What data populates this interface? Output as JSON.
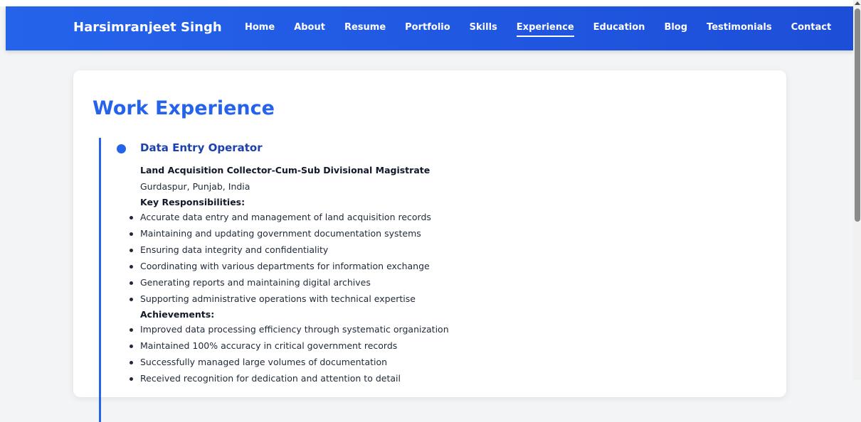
{
  "header": {
    "brand": "Harsimranjeet Singh",
    "nav": [
      {
        "label": "Home"
      },
      {
        "label": "About"
      },
      {
        "label": "Resume"
      },
      {
        "label": "Portfolio"
      },
      {
        "label": "Skills"
      },
      {
        "label": "Experience",
        "active": true
      },
      {
        "label": "Education"
      },
      {
        "label": "Blog"
      },
      {
        "label": "Testimonials"
      },
      {
        "label": "Contact"
      }
    ]
  },
  "main": {
    "title": "Work Experience",
    "job": {
      "title": "Data Entry Operator",
      "company": "Land Acquisition Collector-Cum-Sub Divisional Magistrate",
      "location": "Gurdaspur, Punjab, India",
      "responsibilities_heading": "Key Responsibilities:",
      "responsibilities": [
        "Accurate data entry and management of land acquisition records",
        "Maintaining and updating government documentation systems",
        "Ensuring data integrity and confidentiality",
        "Coordinating with various departments for information exchange",
        "Generating reports and maintaining digital archives",
        "Supporting administrative operations with technical expertise"
      ],
      "achievements_heading": "Achievements:",
      "achievements": [
        "Improved data processing efficiency through systematic organization",
        "Maintained 100% accuracy in critical government records",
        "Successfully managed large volumes of documentation",
        "Received recognition for dedication and attention to detail"
      ]
    }
  },
  "colors": {
    "accent": "#2563eb",
    "job_title": "#1e40af",
    "nav_bg": "#1d4ed8"
  }
}
